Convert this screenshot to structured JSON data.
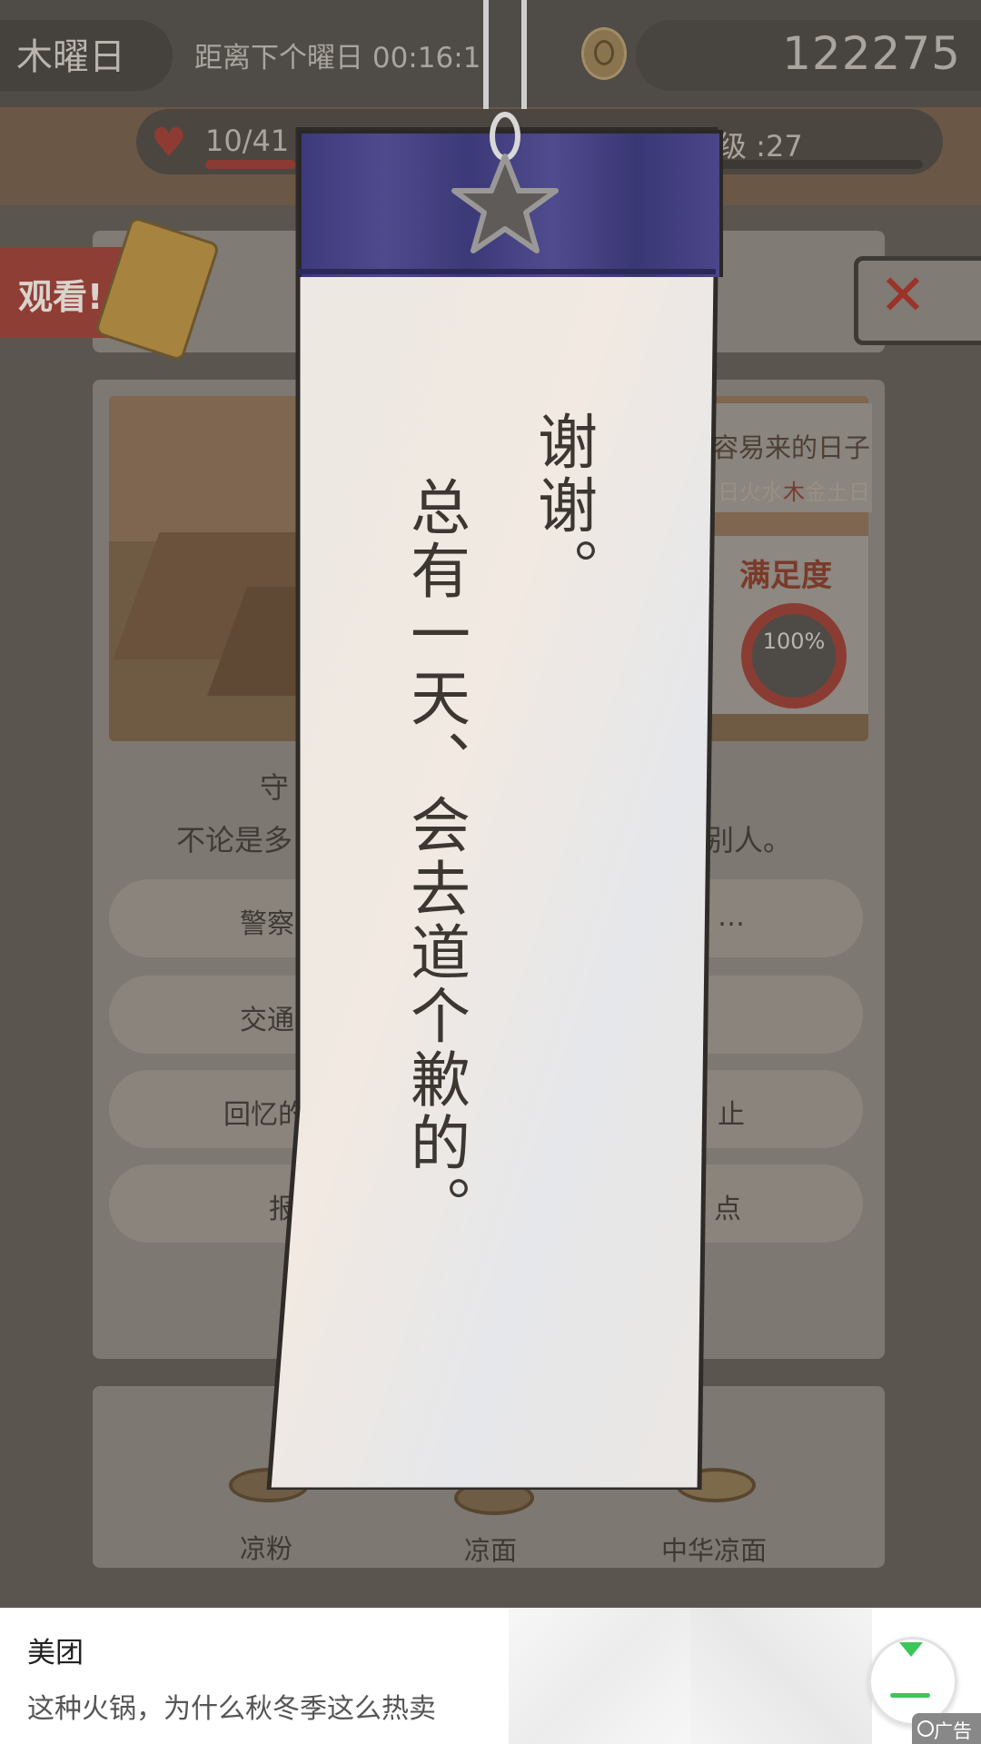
{
  "top": {
    "day": "木曜日",
    "countdown_label": "距离下个曜日 00:16:1",
    "coins": "122275"
  },
  "stats": {
    "hearts": "10/41",
    "hearts_fill": 0.24,
    "level": "级 :27"
  },
  "watch": {
    "label": "观看!"
  },
  "info": {
    "title": "容易来的日子",
    "week_prefix": "日",
    "week_mid1": "火水",
    "week_hi": "木",
    "week_rest": "金土日",
    "satisfaction_label": "满足度",
    "satisfaction_value": "100%"
  },
  "description": {
    "line1": "守",
    "line2_left": "不论是多",
    "line2_right": "别人。"
  },
  "options": [
    {
      "left": "警察",
      "right": "…"
    },
    {
      "left": "交通",
      "right": ""
    },
    {
      "left": "回忆的",
      "right": "止"
    },
    {
      "left": "报",
      "right": "点"
    }
  ],
  "foods": [
    "凉粉",
    "凉面",
    "中华凉面"
  ],
  "tanzaku": {
    "col1": "谢谢。",
    "col2": "总有一天、会去道个歉的。"
  },
  "ad": {
    "brand": "美团",
    "text": "这种火锅，为什么秋冬季这么热卖",
    "tag": "广告"
  },
  "colors": {
    "accent_red": "#9a3329",
    "paper_top": "#4a468a",
    "ad_green": "#3bc65a"
  },
  "icons": [
    "heart-icon",
    "coin-icon",
    "close-icon",
    "star-charm-icon",
    "download-icon",
    "ad-icon"
  ]
}
